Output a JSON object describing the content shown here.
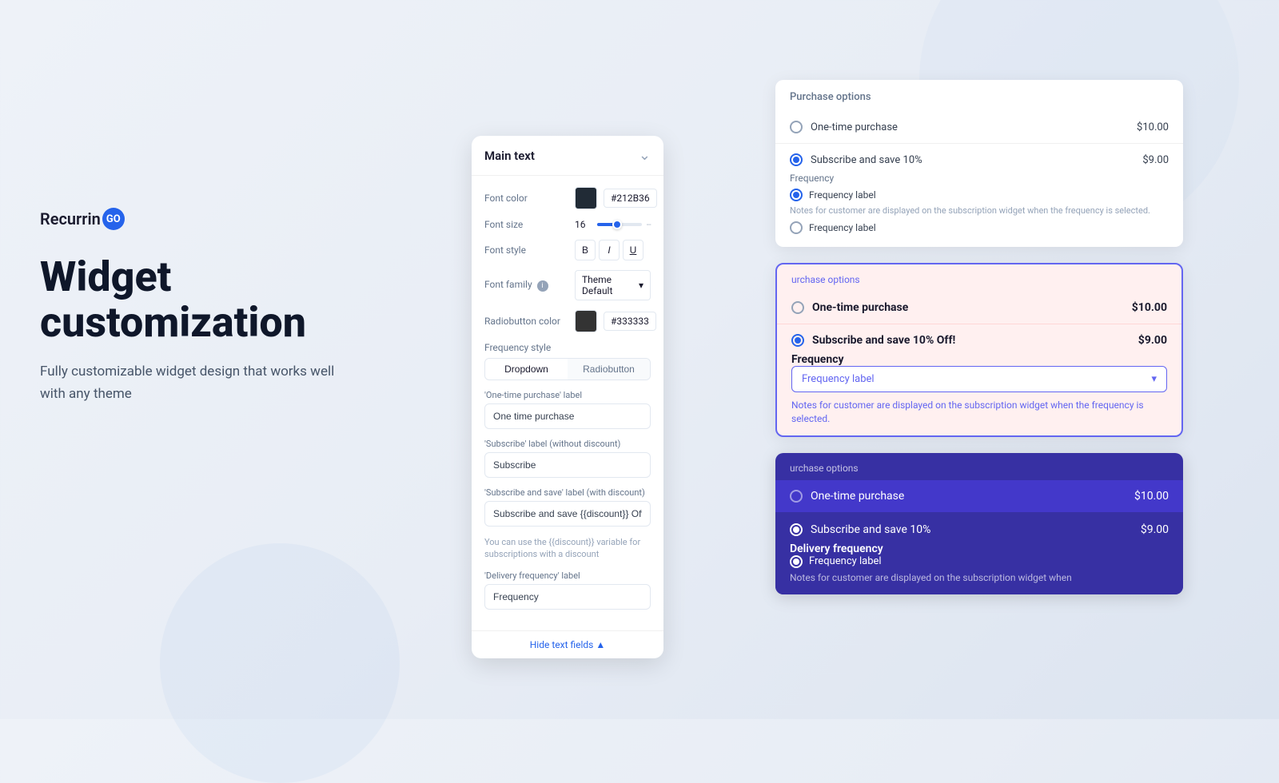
{
  "background": {
    "color": "#eef2f8"
  },
  "logo": {
    "text": "Recurrin",
    "go": "GO"
  },
  "hero": {
    "title": "Widget\ncustomization",
    "subtitle": "Fully customizable widget design that works well with any theme"
  },
  "customization_panel": {
    "header": "Main text",
    "fields": {
      "font_color_label": "Font color",
      "font_color_swatch": "#212B36",
      "font_color_value": "#212B36",
      "font_size_label": "Font size",
      "font_size_value": "16",
      "font_style_label": "Font style",
      "font_style_bold": "B",
      "font_style_italic": "I",
      "font_style_underline": "U",
      "font_family_label": "Font family",
      "font_family_value": "Theme Default",
      "radiobutton_color_label": "Radiobutton color",
      "radiobutton_color_swatch": "#333333",
      "radiobutton_color_value": "#333333",
      "frequency_style_label": "Frequency style",
      "frequency_dropdown": "Dropdown",
      "frequency_radiobutton": "Radiobutton",
      "one_time_label_title": "'One-time purchase' label",
      "one_time_label_value": "One time purchase",
      "subscribe_label_title": "'Subscribe' label (without discount)",
      "subscribe_label_value": "Subscribe",
      "subscribe_save_label_title": "'Subscribe and save' label (with discount)",
      "subscribe_save_label_value": "Subscribe and save {{discount}} Off!",
      "hint_text": "You can use the {{discount}} variable for subscriptions with a discount",
      "delivery_freq_label_title": "'Delivery frequency' label",
      "delivery_freq_value": "Frequency",
      "hide_link": "Hide text fields ▲"
    }
  },
  "preview_panels": {
    "panel1": {
      "title": "Purchase options",
      "option1_label": "One-time purchase",
      "option1_price": "$10.00",
      "option2_label": "Subscribe and save 10%",
      "option2_price": "$9.00",
      "frequency_title": "Frequency",
      "freq_option1": "Frequency label",
      "freq_option2": "Frequency label",
      "notes": "Notes for customer are displayed on the subscription widget when the frequency is selected."
    },
    "panel2": {
      "title": "urchase options",
      "option1_label": "One-time purchase",
      "option1_price": "$10.00",
      "option2_label": "Subscribe and save 10% Off!",
      "option2_price": "$9.00",
      "frequency_title": "Frequency",
      "freq_select": "Frequency label",
      "notes": "Notes for customer are displayed on the subscription widget when the frequency is selected."
    },
    "panel3": {
      "title": "urchase options",
      "option1_label": "One-time purchase",
      "option1_price": "$10.00",
      "option2_label": "Subscribe and save 10%",
      "option2_price": "$9.00",
      "frequency_title": "Delivery frequency",
      "freq_option": "Frequency label",
      "notes": "Notes for customer are displayed on the subscription widget when"
    }
  }
}
